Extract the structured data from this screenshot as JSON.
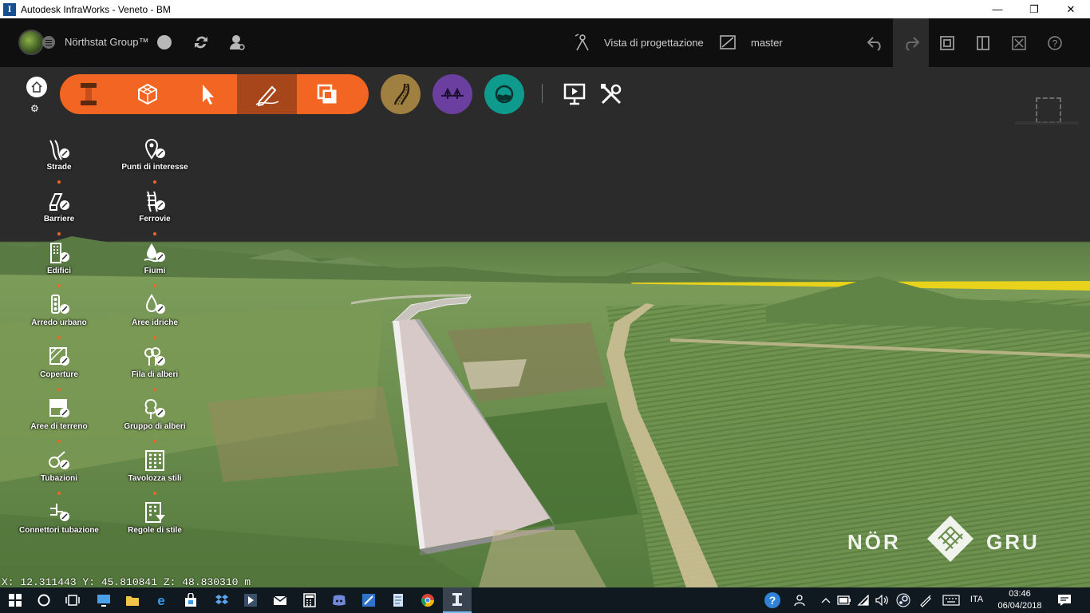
{
  "window": {
    "title": "Autodesk InfraWorks - Veneto - BM",
    "app_glyph": "I",
    "controls": {
      "minimize": "—",
      "restore": "❐",
      "close": "✕"
    }
  },
  "header": {
    "group_name": "Nörthstat Group™",
    "view_label": "Vista di progettazione",
    "branch_label": "master"
  },
  "palette": {
    "left": [
      {
        "id": "strade",
        "label": "Strade"
      },
      {
        "id": "barriere",
        "label": "Barriere"
      },
      {
        "id": "edifici",
        "label": "Edifici"
      },
      {
        "id": "arredo",
        "label": "Arredo urbano"
      },
      {
        "id": "coperture",
        "label": "Coperture"
      },
      {
        "id": "aree-terreno",
        "label": "Aree di terreno"
      },
      {
        "id": "tubazioni",
        "label": "Tubazioni"
      },
      {
        "id": "connettori",
        "label": "Connettori tubazione"
      }
    ],
    "right": [
      {
        "id": "punti",
        "label": "Punti di interesse"
      },
      {
        "id": "ferrovie",
        "label": "Ferrovie"
      },
      {
        "id": "fiumi",
        "label": "Fiumi"
      },
      {
        "id": "aree-idriche",
        "label": "Aree idriche"
      },
      {
        "id": "fila-alberi",
        "label": "Fila di alberi"
      },
      {
        "id": "gruppo-alberi",
        "label": "Gruppo di alberi"
      },
      {
        "id": "tavolozza",
        "label": "Tavolozza stili"
      },
      {
        "id": "regole",
        "label": "Regole di stile"
      }
    ]
  },
  "viewport": {
    "coordinates": "X: 12.311443 Y: 45.810841 Z: 48.830310 m",
    "watermark_left": "NÖR",
    "watermark_right": "GRU"
  },
  "taskbar": {
    "language": "ITA",
    "time": "03:46",
    "date": "06/04/2018"
  },
  "colors": {
    "accent_orange": "#f26522",
    "accent_orange_active": "#a6461a",
    "roads_circle": "#a08040",
    "bridges_circle": "#6b3fa0",
    "drainage_circle": "#0f9a8e"
  }
}
